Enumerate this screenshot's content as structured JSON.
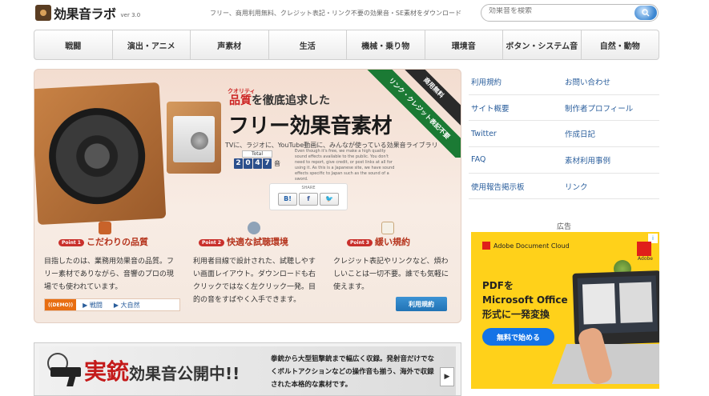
{
  "header": {
    "logo_text": "効果音ラボ",
    "version": "ver 3.0",
    "tagline": "フリー、商用利用無料、クレジット表記・リンク不要の効果音・SE素材をダウンロード",
    "search_placeholder": "効果音を検索"
  },
  "nav": {
    "items": [
      "戦闘",
      "演出・アニメ",
      "声素材",
      "生活",
      "機械・乗り物",
      "環境音",
      "ボタン・システム音",
      "自然・動物"
    ]
  },
  "hero": {
    "quality_ruby": "クオリティ",
    "headline1_red": "品質",
    "headline1_rest": "を徹底追求した",
    "headline2": "フリー効果音素材",
    "sub": "TVに、ラジオに、YouTube動画に、みんなが使っている効果音ライブラリ",
    "total_label": "Total",
    "total_digits": [
      "2",
      "0",
      "4",
      "7"
    ],
    "total_unit": "音",
    "english_text": "Even though it's free, we make a high quality sound effects available to the public. You don't need to report, give credit, or post links at all for using it. As this is a Japanese site, we have sound effects specific to Japan such as the sound of a sword.",
    "share_label": "SHARE",
    "ribbon_commercial": "商用無料",
    "ribbon_credit": "リンク・クレジット表記不要",
    "points": [
      {
        "badge": "Point 1",
        "title": "こだわりの品質",
        "desc": "目指したのは、業務用効果音の品質。フリー素材でありながら、音響のプロの現場でも使われています。"
      },
      {
        "badge": "Point 2",
        "title": "快適な試聴環境",
        "desc": "利用者目線で設計された、試聴しやすい画面レイアウト。ダウンロードも右クリックではなく左クリック一発。目的の音をすばやく入手できます。"
      },
      {
        "badge": "Point 3",
        "title": "緩い規約",
        "desc": "クレジット表記やリンクなど、煩わしいことは一切不要。誰でも気軽に使えます。"
      }
    ],
    "demo_badge": "((DEMO))",
    "demo_links": [
      "▶ 戦闘",
      "▶ 大自然"
    ],
    "terms_button": "利用規約"
  },
  "banner": {
    "title_red": "実銃",
    "title_rest": "効果音公開中!!",
    "desc": "拳銃から大型狙撃銃まで幅広く収録。発射音だけでなくボルトアクションなどの操作音も揃う、海外で収録された本格的な素材です。"
  },
  "sidebar": {
    "rows": [
      [
        "利用規約",
        "お問い合わせ"
      ],
      [
        "サイト概要",
        "制作者プロフィール"
      ],
      [
        "Twitter",
        "作成日記"
      ],
      [
        "FAQ",
        "素材利用事例"
      ],
      [
        "使用報告掲示板",
        "リンク"
      ]
    ],
    "ad_label": "広告"
  },
  "ad": {
    "brand": "Adobe Document Cloud",
    "headline_lines": [
      "PDFを",
      "Microsoft Office",
      "形式に一発変換"
    ],
    "button": "無料で始める",
    "logo_text": "Adobe"
  }
}
